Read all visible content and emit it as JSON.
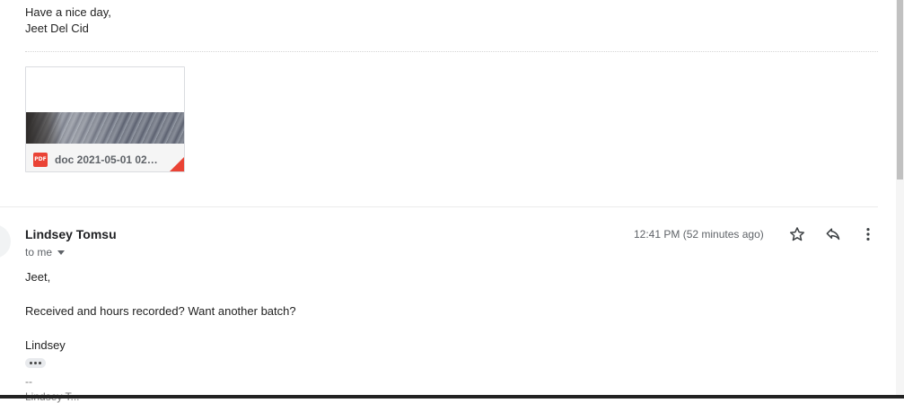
{
  "previous_message": {
    "closing": "Have a nice day,",
    "signature": "Jeet Del Cid",
    "attachment": {
      "type_badge": "PDF",
      "filename": "doc 2021-05-01 02…",
      "icon": "pdf-icon"
    }
  },
  "message": {
    "sender": "Lindsey Tomsu",
    "recipient_label": "to me",
    "timestamp": "12:41 PM (52 minutes ago)",
    "actions": {
      "star_icon": "star-icon",
      "reply_icon": "reply-icon",
      "more_icon": "more-vert-icon"
    },
    "body": {
      "greeting": "Jeet,",
      "text": "Received and hours recorded? Want another batch?",
      "signoff": "Lindsey"
    },
    "signature_separator": "--",
    "signature_partial": "Lindsey T..."
  },
  "colors": {
    "accent_red": "#ea4335",
    "muted_text": "#5f6368"
  }
}
